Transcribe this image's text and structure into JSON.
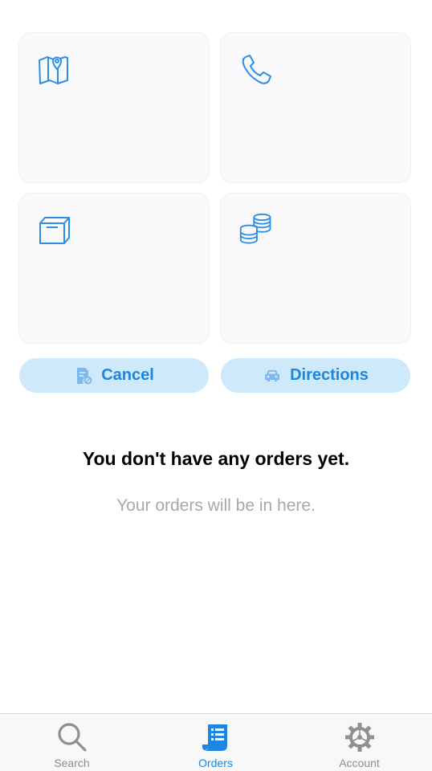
{
  "actions": {
    "cancel_label": "Cancel",
    "directions_label": "Directions"
  },
  "cards": [
    {
      "icon": "map-pin-icon"
    },
    {
      "icon": "phone-icon"
    },
    {
      "icon": "box-icon"
    },
    {
      "icon": "coins-icon"
    }
  ],
  "empty_state": {
    "title": "You don't have any orders yet.",
    "subtitle": "Your orders will be in here."
  },
  "tabs": [
    {
      "label": "Search",
      "icon": "search-icon",
      "active": false
    },
    {
      "label": "Orders",
      "icon": "receipt-icon",
      "active": true
    },
    {
      "label": "Account",
      "icon": "gear-icon",
      "active": false
    }
  ],
  "colors": {
    "accent": "#1d86e0",
    "pill_bg": "#cde9fa",
    "inactive": "#8e8e93",
    "subtitle": "#a8a8ad"
  }
}
